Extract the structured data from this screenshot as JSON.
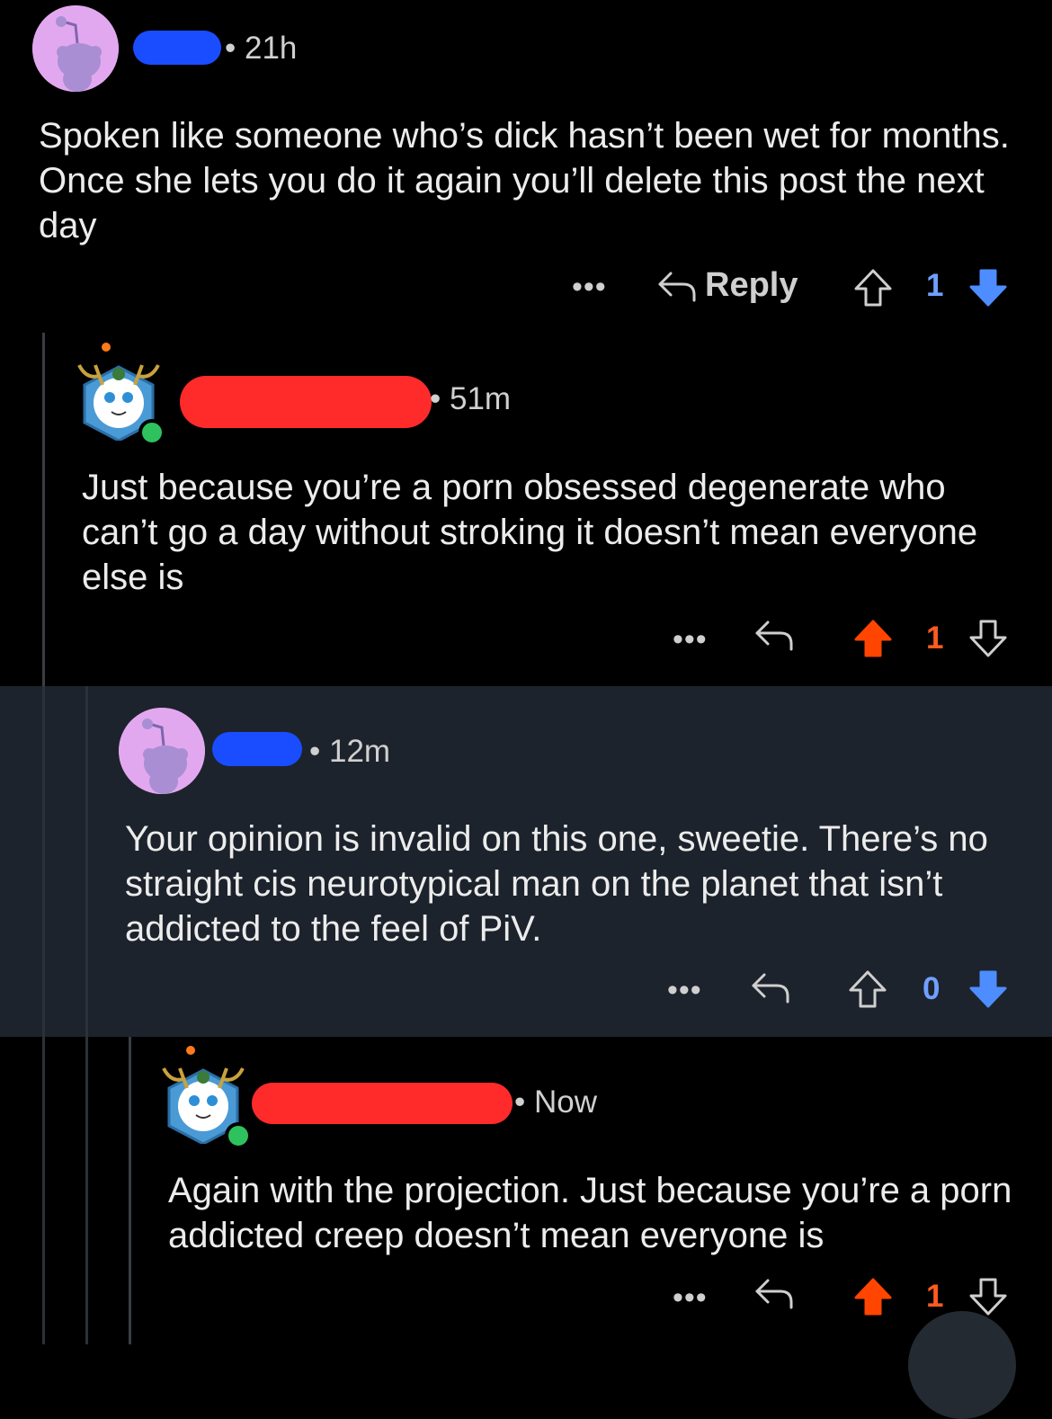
{
  "colors": {
    "upvote_active": "#ff4500",
    "downvote_active": "#4d8dff",
    "highlight_bg": "#1d232c",
    "redaction_blue": "#1a4dff",
    "redaction_red": "#ff2b2b"
  },
  "comments": [
    {
      "time": "• 21h",
      "avatar": "snoo-avatar",
      "text": "Spoken like someone who’s dick hasn’t been wet for months. Once she lets you do it again you’ll delete this post the next day",
      "more": "•••",
      "reply_label": "Reply",
      "score": "1",
      "vote_state": "downvoted"
    },
    {
      "time": "• 51m",
      "avatar": "cat-avatar",
      "text": "Just because you’re a porn obsessed degenerate who can’t go a day without stroking it doesn’t mean everyone else is",
      "more": "•••",
      "score": "1",
      "vote_state": "upvoted"
    },
    {
      "time": "• 12m",
      "avatar": "snoo-avatar",
      "text": "Your opinion is invalid on this one, sweetie. There’s no straight cis neurotypical man on the planet that isn’t addicted to the feel of PiV.",
      "more": "•••",
      "score": "0",
      "vote_state": "downvoted"
    },
    {
      "time": "• Now",
      "avatar": "cat-avatar",
      "text": "Again with the projection. Just because you’re a porn addicted creep doesn’t mean everyone is",
      "more": "•••",
      "score": "1",
      "vote_state": "upvoted"
    }
  ]
}
